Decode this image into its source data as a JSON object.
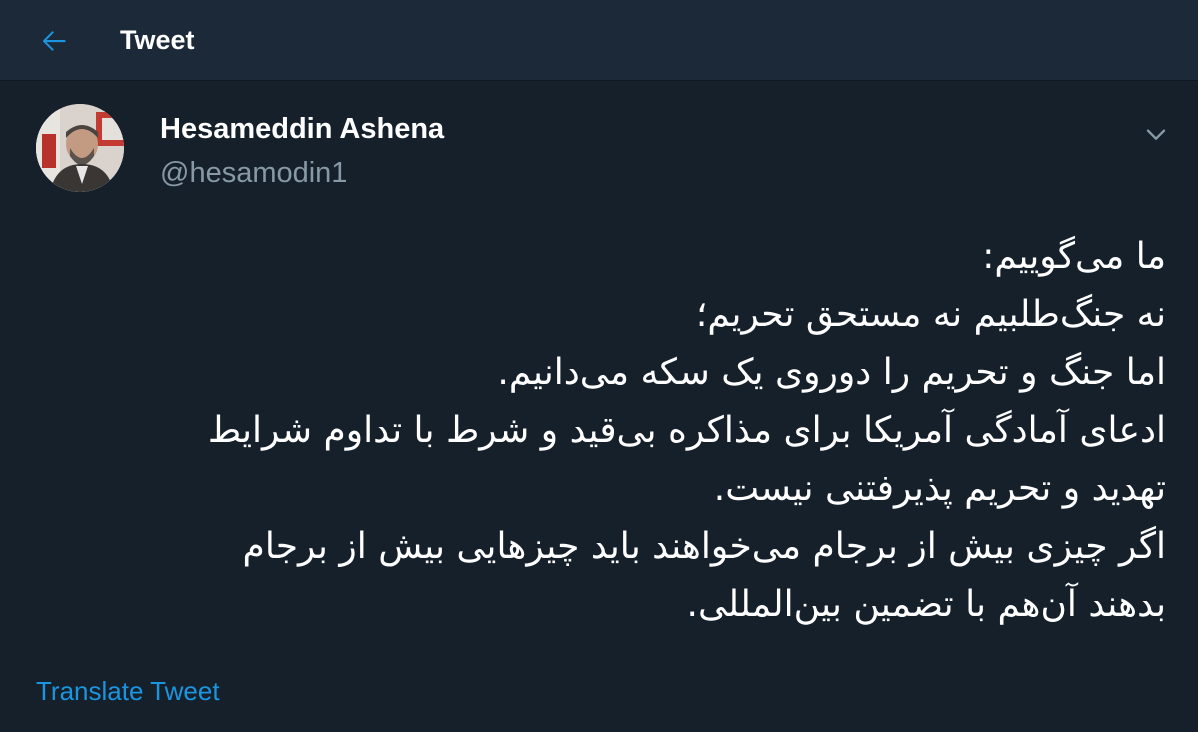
{
  "header": {
    "back_icon": "arrow-left-icon",
    "title": "Tweet"
  },
  "author": {
    "display_name": "Hesameddin Ashena",
    "handle": "@hesamodin1",
    "avatar_icon": "profile-photo"
  },
  "more_icon": "chevron-down-icon",
  "tweet": {
    "lines": [
      "ما می‌گوییم:",
      "نه جنگ‌طلبیم نه مستحق تحریم؛",
      "اما جنگ و تحریم را دوروی یک سکه می‌دانیم.",
      "ادعای آمادگی آمریکا برای مذاکره بی‌قید و شرط با تداوم شرایط",
      "تهدید و تحریم پذیرفتنی نیست.",
      "اگر چیزی بیش از برجام می‌خواهند باید چیزهایی بیش از برجام",
      "بدهند آن‌هم با تضمین بین‌المللی."
    ]
  },
  "translate_label": "Translate Tweet",
  "colors": {
    "background": "#15202b",
    "header_bg": "#1c2938",
    "accent": "#1b95e0",
    "secondary_text": "#8899a6"
  }
}
